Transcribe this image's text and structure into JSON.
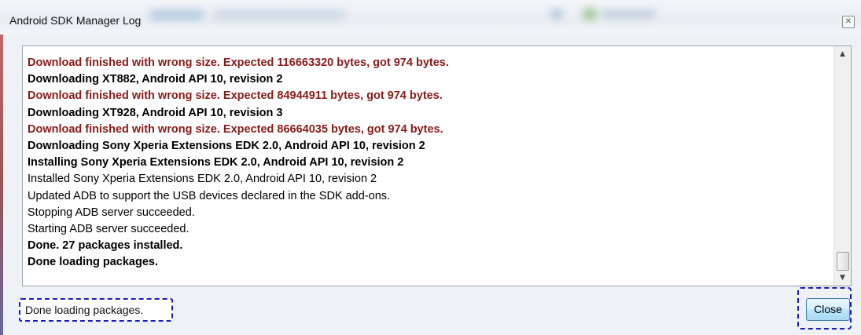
{
  "window": {
    "title": "Android SDK Manager Log",
    "close_glyph": "✕"
  },
  "log": {
    "lines": [
      {
        "text": "Download finished with wrong size. Expected 116663320 bytes, got 974 bytes.",
        "style": "err"
      },
      {
        "text": "Downloading XT882, Android API 10, revision 2",
        "style": "bold"
      },
      {
        "text": "Download finished with wrong size. Expected 84944911 bytes, got 974 bytes.",
        "style": "err"
      },
      {
        "text": "Downloading XT928, Android API 10, revision 3",
        "style": "bold"
      },
      {
        "text": "Download finished with wrong size. Expected 86664035 bytes, got 974 bytes.",
        "style": "err"
      },
      {
        "text": "Downloading Sony Xperia Extensions EDK 2.0, Android API 10, revision 2",
        "style": "bold"
      },
      {
        "text": "Installing Sony Xperia Extensions EDK 2.0, Android API 10, revision 2",
        "style": "bold"
      },
      {
        "text": "Installed Sony Xperia Extensions EDK 2.0, Android API 10, revision 2",
        "style": "normal"
      },
      {
        "text": "Updated ADB to support the USB devices declared in the SDK add-ons.",
        "style": "normal"
      },
      {
        "text": "Stopping ADB server succeeded.",
        "style": "normal"
      },
      {
        "text": "Starting ADB server succeeded.",
        "style": "normal"
      },
      {
        "text": "Done. 27 packages installed.",
        "style": "bold"
      },
      {
        "text": "Done loading packages.",
        "style": "bold"
      }
    ]
  },
  "scrollbar": {
    "up_glyph": "▲",
    "down_glyph": "▼"
  },
  "status": {
    "text": "Done loading packages."
  },
  "buttons": {
    "close_label": "Close"
  },
  "colors": {
    "error_text": "#8b1a1a",
    "highlight_border": "#1a1acc"
  }
}
